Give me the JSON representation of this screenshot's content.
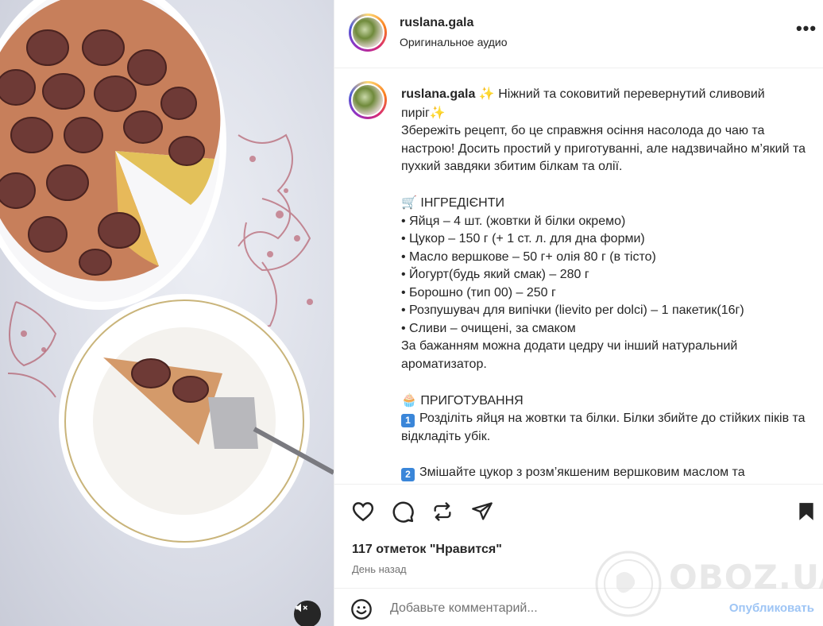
{
  "post": {
    "username": "ruslana.gala",
    "audio_label": "Оригинальное аудио",
    "more_label": "•••"
  },
  "caption": {
    "username": "ruslana.gala",
    "title_emoji": "✨",
    "title": "Ніжний та соковитий перевернутий сливовий пиріг",
    "title_emoji_end": "✨",
    "intro": "Збережіть рецепт, бо це справжня осіння насолода до чаю та настрою! Досить простий у приготуванні, але надзвичайно м’який та пухкий завдяки збитим білкам та олії.",
    "ingredients_emoji": "🛒",
    "ingredients_heading": "ІНГРЕДІЄНТИ",
    "ingredients": [
      "• Яйця – 4 шт. (жовтки й білки окремо)",
      "• Цукор – 150 г (+ 1 ст. л. для дна форми)",
      "• Масло вершкове – 50 г+ олія 80 г (в тісто)",
      "• Йогурт(будь який смак) – 280 г",
      "• Борошно (тип 00) – 250 г",
      "• Розпушувач для випічки (lievito per dolci) – 1 пакетик(16г)",
      "• Сливи – очищені, за смаком"
    ],
    "ingredients_note": "За бажанням можна додати цедру чи інший натуральний ароматизатор.",
    "method_emoji": "🧁",
    "method_heading": "ПРИГОТУВАННЯ",
    "steps": [
      {
        "num": "1",
        "text": "Розділіть яйця на жовтки та білки. Білки збийте до стійких піків та відкладіть убік."
      },
      {
        "num": "2",
        "text": "Змішайте цукор з розм’якшеним вершковим маслом та жовтками. Збийте до однорідної маси."
      }
    ]
  },
  "actions": {
    "like_icon": "heart-icon",
    "comment_icon": "comment-icon",
    "share_icon": "repost-icon",
    "send_icon": "send-icon",
    "save_icon": "bookmark-icon",
    "likes_text": "117 отметок \"Нравится\"",
    "time_text": "День назад"
  },
  "comment": {
    "placeholder": "Добавьте комментарий...",
    "publish_label": "Опубликовать"
  },
  "watermark": {
    "text": "OBOZ.UA"
  },
  "colors": {
    "accent": "#0095f6",
    "publish_disabled": "#9ec5f5",
    "text": "#262626",
    "secondary": "#737373",
    "border": "#efefef"
  }
}
